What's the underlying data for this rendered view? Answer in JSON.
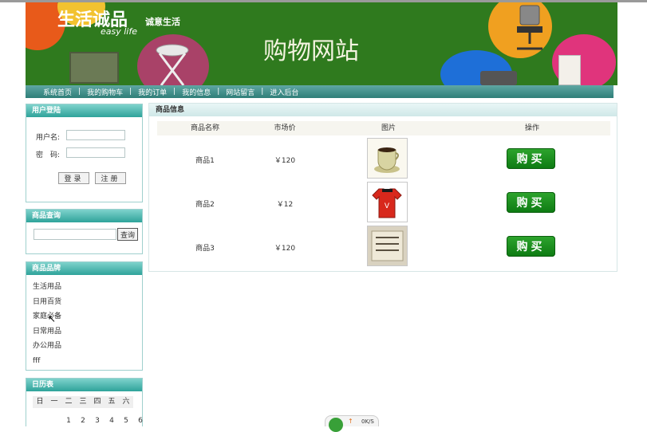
{
  "header": {
    "brand": "生活诚品",
    "tagline": "诚意生活",
    "easy_life": "easy life",
    "site_title": "购物网站"
  },
  "nav": {
    "items": [
      "系统首页",
      "我的购物车",
      "我的订单",
      "我的信息",
      "网站留言",
      "进入后台"
    ],
    "separator": "|"
  },
  "login": {
    "title": "用户登陆",
    "username_label": "用户名:",
    "password_label": "密　码:",
    "login_button": "登录",
    "register_button": "注册"
  },
  "search": {
    "title": "商品查询",
    "button": "查询"
  },
  "brands": {
    "title": "商品品牌",
    "items": [
      "生活用品",
      "日用百货",
      "家庭必备",
      "日常用品",
      "办公用品",
      "fff"
    ]
  },
  "calendar": {
    "title": "日历表",
    "weekdays": [
      "日",
      "一",
      "二",
      "三",
      "四",
      "五",
      "六"
    ],
    "first_row": [
      "",
      "",
      "1",
      "2",
      "3",
      "4",
      "5",
      "6"
    ]
  },
  "products": {
    "title": "商品信息",
    "columns": [
      "商品名称",
      "市场价",
      "图片",
      "操作"
    ],
    "buy_label": "购买",
    "rows": [
      {
        "name": "商品1",
        "price": "￥120",
        "image_icon": "coffee-cup-icon"
      },
      {
        "name": "商品2",
        "price": "￥12",
        "image_icon": "jersey-icon"
      },
      {
        "name": "商品3",
        "price": "￥120",
        "image_icon": "book-icon"
      }
    ]
  },
  "speed_widget": {
    "rate": "0K/S"
  },
  "colors": {
    "banner_green": "#2f7a1e",
    "nav_teal": "#2e7e78",
    "panel_head": "#2fa39a",
    "buy_green": "#0d7a12"
  }
}
